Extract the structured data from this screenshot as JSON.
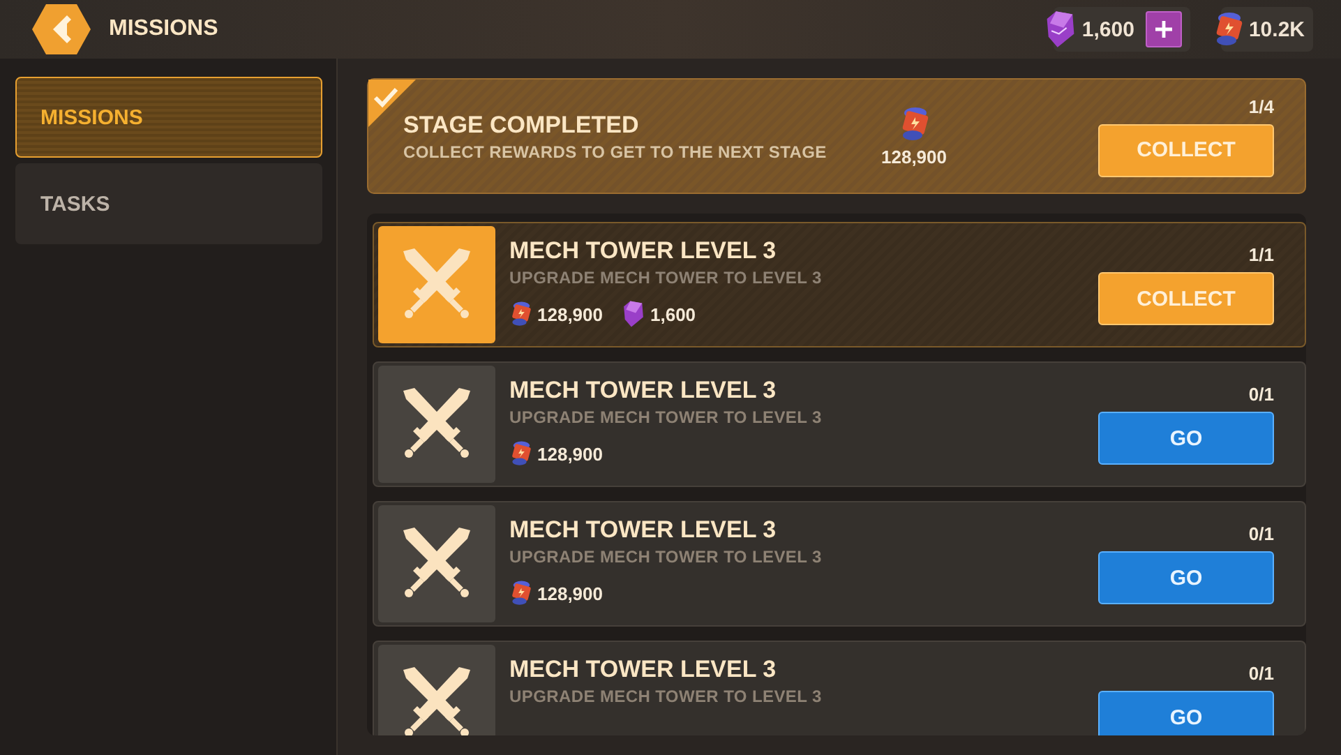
{
  "header": {
    "title": "MISSIONS",
    "currencies": [
      {
        "kind": "crystal",
        "amount": "1,600",
        "addable": true
      },
      {
        "kind": "energy",
        "amount": "10.2K",
        "addable": false
      }
    ]
  },
  "sidebar": {
    "items": [
      {
        "label": "MISSIONS",
        "selected": true
      },
      {
        "label": "TASKS",
        "selected": false
      }
    ]
  },
  "stage": {
    "completed": true,
    "title": "STAGE COMPLETED",
    "subtitle": "COLLECT REWARDS TO GET TO THE NEXT STAGE",
    "reward": {
      "kind": "energy",
      "amount": "128,900"
    },
    "progress": "1/4",
    "button": "COLLECT"
  },
  "missions": [
    {
      "title": "MECH TOWER LEVEL 3",
      "subtitle": "UPGRADE MECH TOWER TO LEVEL 3",
      "progress": "1/1",
      "completed": true,
      "button": "COLLECT",
      "rewards": [
        {
          "kind": "energy",
          "amount": "128,900"
        },
        {
          "kind": "crystal",
          "amount": "1,600"
        }
      ]
    },
    {
      "title": "MECH TOWER LEVEL 3",
      "subtitle": "UPGRADE MECH TOWER TO LEVEL 3",
      "progress": "0/1",
      "completed": false,
      "button": "GO",
      "rewards": [
        {
          "kind": "energy",
          "amount": "128,900"
        }
      ]
    },
    {
      "title": "MECH TOWER LEVEL 3",
      "subtitle": "UPGRADE MECH TOWER TO LEVEL 3",
      "progress": "0/1",
      "completed": false,
      "button": "GO",
      "rewards": [
        {
          "kind": "energy",
          "amount": "128,900"
        }
      ]
    },
    {
      "title": "MECH TOWER LEVEL 3",
      "subtitle": "UPGRADE MECH TOWER TO LEVEL 3",
      "progress": "0/1",
      "completed": false,
      "button": "GO"
    }
  ]
}
